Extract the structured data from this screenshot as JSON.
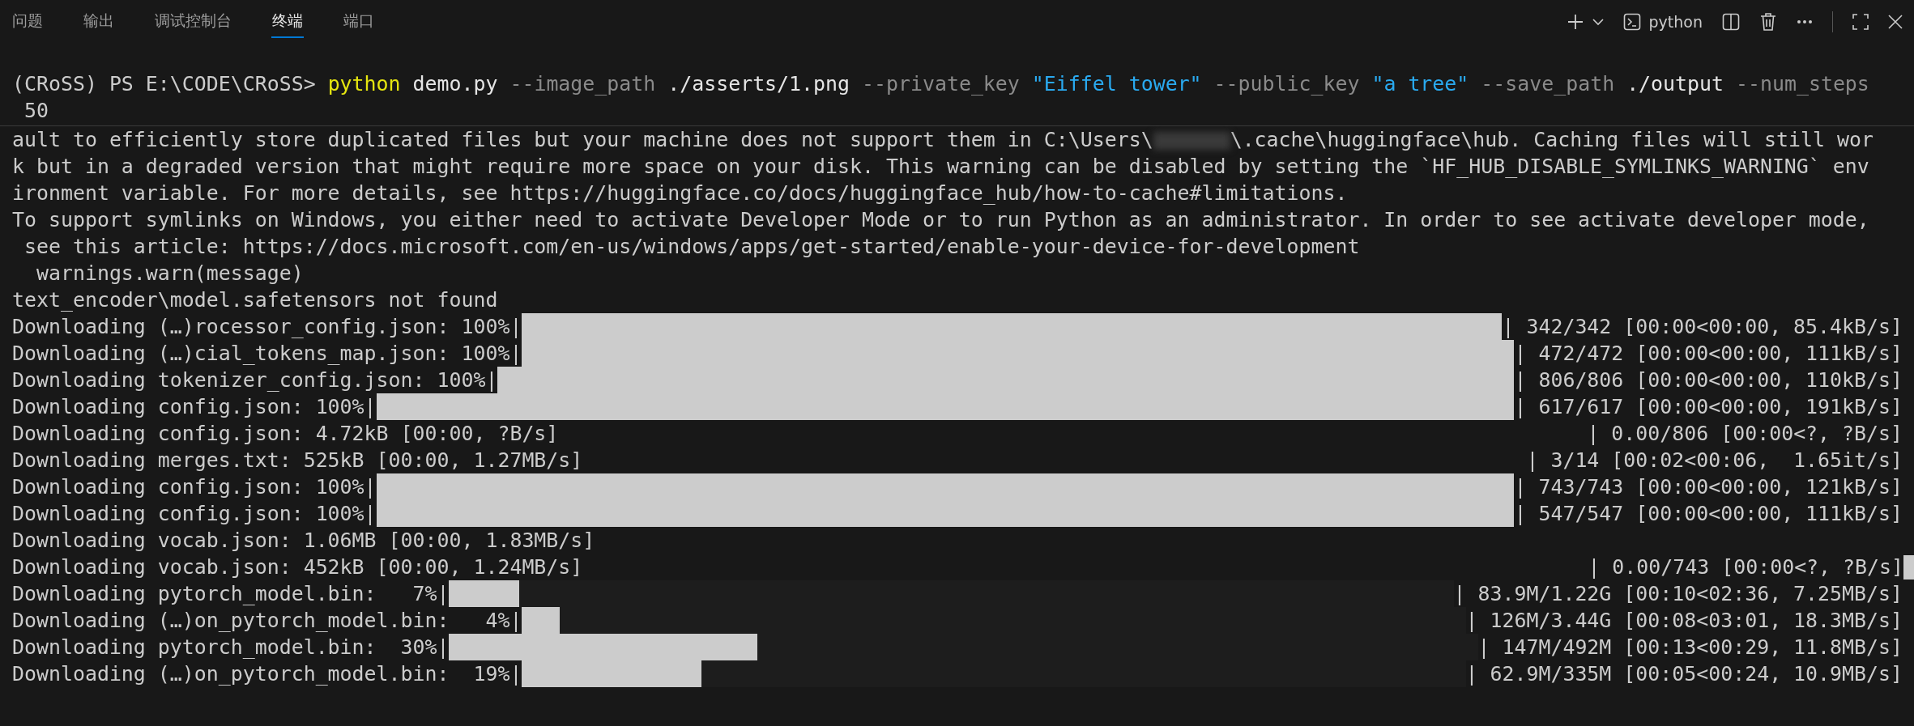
{
  "tabs": [
    {
      "label": "问题",
      "selected": false
    },
    {
      "label": "输出",
      "selected": false
    },
    {
      "label": "调试控制台",
      "selected": false
    },
    {
      "label": "终端",
      "selected": true
    },
    {
      "label": "端口",
      "selected": false
    }
  ],
  "terminal_profile": "python",
  "command": [
    {
      "text": "(CRoSS) PS E:\\CODE\\CRoSS> ",
      "kind": "prompt"
    },
    {
      "text": "python",
      "kind": "command"
    },
    {
      "text": " demo.py ",
      "kind": "argument"
    },
    {
      "text": "--image_path",
      "kind": "parameter"
    },
    {
      "text": " ./asserts/1.png ",
      "kind": "argument"
    },
    {
      "text": "--private_key",
      "kind": "parameter"
    },
    {
      "text": " \"Eiffel tower\" ",
      "kind": "string"
    },
    {
      "text": "--public_key",
      "kind": "parameter"
    },
    {
      "text": " \"a tree\" ",
      "kind": "string"
    },
    {
      "text": "--save_path",
      "kind": "parameter"
    },
    {
      "text": " ./output ",
      "kind": "argument"
    },
    {
      "text": "--num_steps",
      "kind": "parameter"
    }
  ],
  "command_continuation": " 50",
  "output": [
    {
      "kind": "redacted",
      "before": "ault to efficiently store duplicated files but your machine does not support them in C:\\Users\\",
      "after": "\\.cache\\huggingface\\hub. Caching files will still wor"
    },
    {
      "kind": "text",
      "text": "k but in a degraded version that might require more space on your disk. This warning can be disabled by setting the `HF_HUB_DISABLE_SYMLINKS_WARNING` env"
    },
    {
      "kind": "text",
      "text": "ironment variable. For more details, see https://huggingface.co/docs/huggingface_hub/how-to-cache#limitations."
    },
    {
      "kind": "text",
      "text": "To support symlinks on Windows, you either need to activate Developer Mode or to run Python as an administrator. In order to see activate developer mode,"
    },
    {
      "kind": "text",
      "text": " see this article: https://docs.microsoft.com/en-us/windows/apps/get-started/enable-your-device-for-development"
    },
    {
      "kind": "text",
      "text": "  warnings.warn(message)"
    },
    {
      "kind": "text",
      "text": "text_encoder\\model.safetensors not found"
    },
    {
      "kind": "progress",
      "label": "Downloading (…)rocessor_config.json: 100%|",
      "level": 1,
      "stats": "| 342/342 [00:00<00:00, 85.4kB/s]"
    },
    {
      "kind": "progress",
      "label": "Downloading (…)cial_tokens_map.json: 100%|",
      "level": 1,
      "stats": "| 472/472 [00:00<00:00, 111kB/s]"
    },
    {
      "kind": "progress",
      "label": "Downloading tokenizer_config.json: 100%|",
      "level": 1,
      "stats": "| 806/806 [00:00<00:00, 110kB/s]"
    },
    {
      "kind": "progress",
      "label": "Downloading config.json: 100%|",
      "level": 1,
      "stats": "| 617/617 [00:00<00:00, 191kB/s]"
    },
    {
      "kind": "split",
      "left": "Downloading config.json: 4.72kB [00:00, ?B/s]",
      "right": "| 0.00/806 [00:00<?, ?B/s]"
    },
    {
      "kind": "split",
      "left": "Downloading merges.txt: 525kB [00:00, 1.27MB/s]",
      "right": "| 3/14 [00:02<00:06,  1.65it/s]"
    },
    {
      "kind": "progress",
      "label": "Downloading config.json: 100%|",
      "level": 1,
      "stats": "| 743/743 [00:00<00:00, 121kB/s]"
    },
    {
      "kind": "progress",
      "label": "Downloading config.json: 100%|",
      "level": 1,
      "stats": "| 547/547 [00:00<00:00, 111kB/s]"
    },
    {
      "kind": "text",
      "text": "Downloading vocab.json: 1.06MB [00:00, 1.83MB/s]"
    },
    {
      "kind": "split",
      "left": "Downloading vocab.json: 452kB [00:00, 1.24MB/s]",
      "right": "| 0.00/743 [00:00<?, ?B/s]",
      "cursor": true
    },
    {
      "kind": "progress",
      "label": "Downloading pytorch_model.bin:   7%|",
      "level": 0.07,
      "stats": "| 83.9M/1.22G [00:10<02:36, 7.25MB/s]"
    },
    {
      "kind": "progress",
      "label": "Downloading (…)on_pytorch_model.bin:   4%|",
      "level": 0.04,
      "stats": "| 126M/3.44G [00:08<03:01, 18.3MB/s]"
    },
    {
      "kind": "progress",
      "label": "Downloading pytorch_model.bin:  30%|",
      "level": 0.3,
      "stats": "| 147M/492M [00:13<00:29, 11.8MB/s]"
    },
    {
      "kind": "progress",
      "label": "Downloading (…)on_pytorch_model.bin:  19%|",
      "level": 0.19,
      "stats": "| 62.9M/335M [00:05<00:24, 10.9MB/s]"
    }
  ]
}
